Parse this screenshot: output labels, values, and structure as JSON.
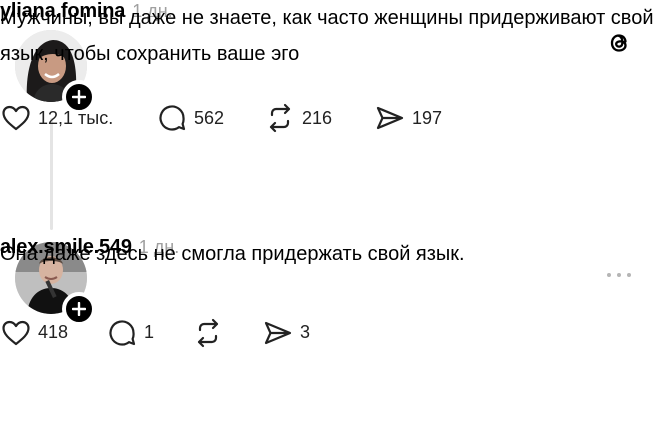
{
  "posts": [
    {
      "username": "yliana.fomina",
      "time": "1 дн.",
      "text": "Мужчины, вы даже не знаете, как часто женщины придерживают свой язык, чтобы сохранить ваше эго",
      "likes": "12,1 тыс.",
      "replies": "562",
      "reposts": "216",
      "shares": "197"
    },
    {
      "username": "alex.smile.549",
      "time": "1 дн.",
      "text": "Она даже здесь не смогла придержать свой язык.",
      "likes": "418",
      "replies": "1",
      "reposts": "",
      "shares": "3"
    }
  ],
  "icons": {
    "app_logo": "threads-logo-icon",
    "more": "more-horizontal-icon",
    "like": "heart-icon",
    "reply": "comment-icon",
    "repost": "repost-icon",
    "share": "share-icon",
    "follow": "plus-icon"
  },
  "colors": {
    "text": "#000000",
    "secondary": "#a0a0a0",
    "thread_line": "#e4e4e4",
    "background": "#ffffff"
  }
}
